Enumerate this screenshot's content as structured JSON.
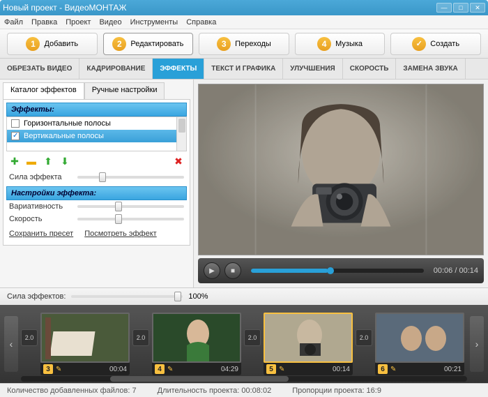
{
  "window": {
    "title": "Новый проект - ВидеоМОНТАЖ"
  },
  "menu": [
    "Файл",
    "Правка",
    "Проект",
    "Видео",
    "Инструменты",
    "Справка"
  ],
  "steps": [
    {
      "num": "1",
      "label": "Добавить"
    },
    {
      "num": "2",
      "label": "Редактировать"
    },
    {
      "num": "3",
      "label": "Переходы"
    },
    {
      "num": "4",
      "label": "Музыка"
    },
    {
      "check": true,
      "label": "Создать"
    }
  ],
  "activeStep": 1,
  "tabs": [
    "ОБРЕЗАТЬ ВИДЕО",
    "КАДРИРОВАНИЕ",
    "ЭФФЕКТЫ",
    "ТЕКСТ И ГРАФИКА",
    "УЛУЧШЕНИЯ",
    "СКОРОСТЬ",
    "ЗАМЕНА ЗВУКА"
  ],
  "activeTab": 2,
  "subtabs": {
    "catalog": "Каталог эффектов",
    "manual": "Ручные настройки"
  },
  "fx": {
    "header": "Эффекты:",
    "items": [
      {
        "label": "Горизонтальные полосы",
        "checked": false
      },
      {
        "label": "Вертикальные полосы",
        "checked": true
      }
    ],
    "strength": "Сила эффекта",
    "settingsHeader": "Настройки эффекта:",
    "variability": "Вариативность",
    "speed": "Скорость",
    "savePreset": "Сохранить пресет",
    "viewEffect": "Посмотреть эффект"
  },
  "bottomSlider": {
    "label": "Сила эффектов:",
    "value": "100%"
  },
  "playback": {
    "current": "00:06",
    "total": "00:14",
    "sep": " / "
  },
  "clips": [
    {
      "idx": "3",
      "dur": "00:04",
      "trans": "2.0"
    },
    {
      "idx": "4",
      "dur": "04:29",
      "trans": "2.0"
    },
    {
      "idx": "5",
      "dur": "00:14",
      "trans": "2.0",
      "selected": true,
      "star": true
    },
    {
      "idx": "6",
      "dur": "00:21",
      "trans": "2.0"
    }
  ],
  "leadTrans": "2.0",
  "status": {
    "files": "Количество добавленных файлов:  7",
    "duration": "Длительность проекта:   00:08:02",
    "aspect": "Пропорции проекта:   16:9"
  },
  "colors": {
    "accent": "#29a0d8",
    "gold": "#f8c040"
  }
}
